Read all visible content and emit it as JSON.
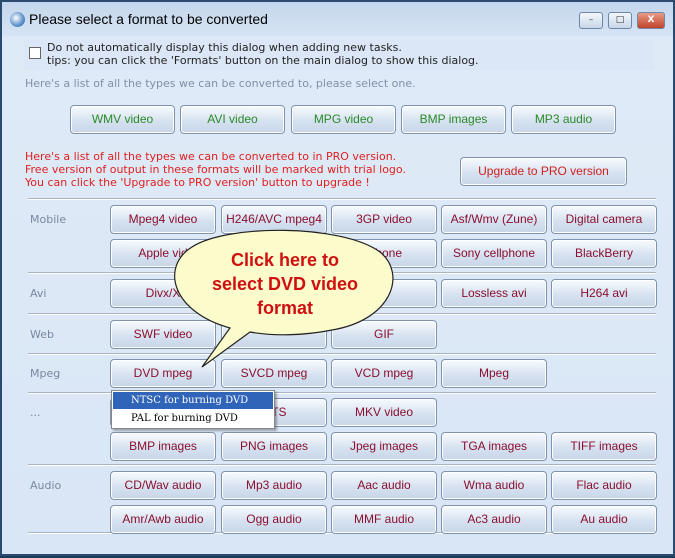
{
  "window": {
    "title": "Please select a format to be converted",
    "minimize": "–",
    "maximize": "□",
    "close": "X"
  },
  "notice": {
    "checkbox_label": "Do not automatically display this dialog when adding new tasks.",
    "tip": "tips: you can click the 'Formats' button on the main dialog to show this dialog.",
    "checked": false
  },
  "hint": "Here's a list of all the types we can be converted to, please select one.",
  "free_formats": [
    "WMV video",
    "AVI video",
    "MPG video",
    "BMP images",
    "MP3 audio"
  ],
  "pro": {
    "lines": [
      "Here's a list of all the types we can be converted to in PRO version.",
      "Free version of output in these formats will be marked with trial logo.",
      "You can click the 'Upgrade to PRO version' button to upgrade !"
    ],
    "upgrade_label": "Upgrade to PRO version"
  },
  "categories": [
    {
      "label": "Mobile",
      "rows": [
        [
          "Mpeg4 video",
          "H246/AVC mpeg4",
          "3GP video",
          "Asf/Wmv (Zune)",
          "Digital camera"
        ],
        [
          "Apple vid",
          "",
          "lphone",
          "Sony cellphone",
          "BlackBerry"
        ]
      ]
    },
    {
      "label": "Avi",
      "rows": [
        [
          "Divx/X",
          "",
          "i",
          "Lossless avi",
          "H264 avi"
        ]
      ]
    },
    {
      "label": "Web",
      "rows": [
        [
          "SWF video",
          "",
          "GIF"
        ]
      ]
    },
    {
      "label": "Mpeg",
      "rows": [
        [
          "DVD mpeg",
          "SVCD mpeg",
          "VCD mpeg",
          "Mpeg"
        ]
      ]
    },
    {
      "label": "...",
      "rows": [
        [
          "",
          "2 TS",
          "MKV video"
        ],
        [
          "BMP images",
          "PNG images",
          "Jpeg images",
          "TGA images",
          "TIFF images"
        ]
      ]
    },
    {
      "label": "Audio",
      "rows": [
        [
          "CD/Wav audio",
          "Mp3 audio",
          "Aac audio",
          "Wma audio",
          "Flac audio"
        ],
        [
          "Amr/Awb audio",
          "Ogg audio",
          "MMF audio",
          "Ac3 audio",
          "Au audio"
        ]
      ]
    }
  ],
  "dvd_menu": {
    "items": [
      "NTSC for burning DVD",
      "PAL for burning DVD"
    ],
    "selected": 0
  },
  "callout": {
    "lines": [
      "Click here to",
      "select DVD video",
      "format"
    ]
  }
}
